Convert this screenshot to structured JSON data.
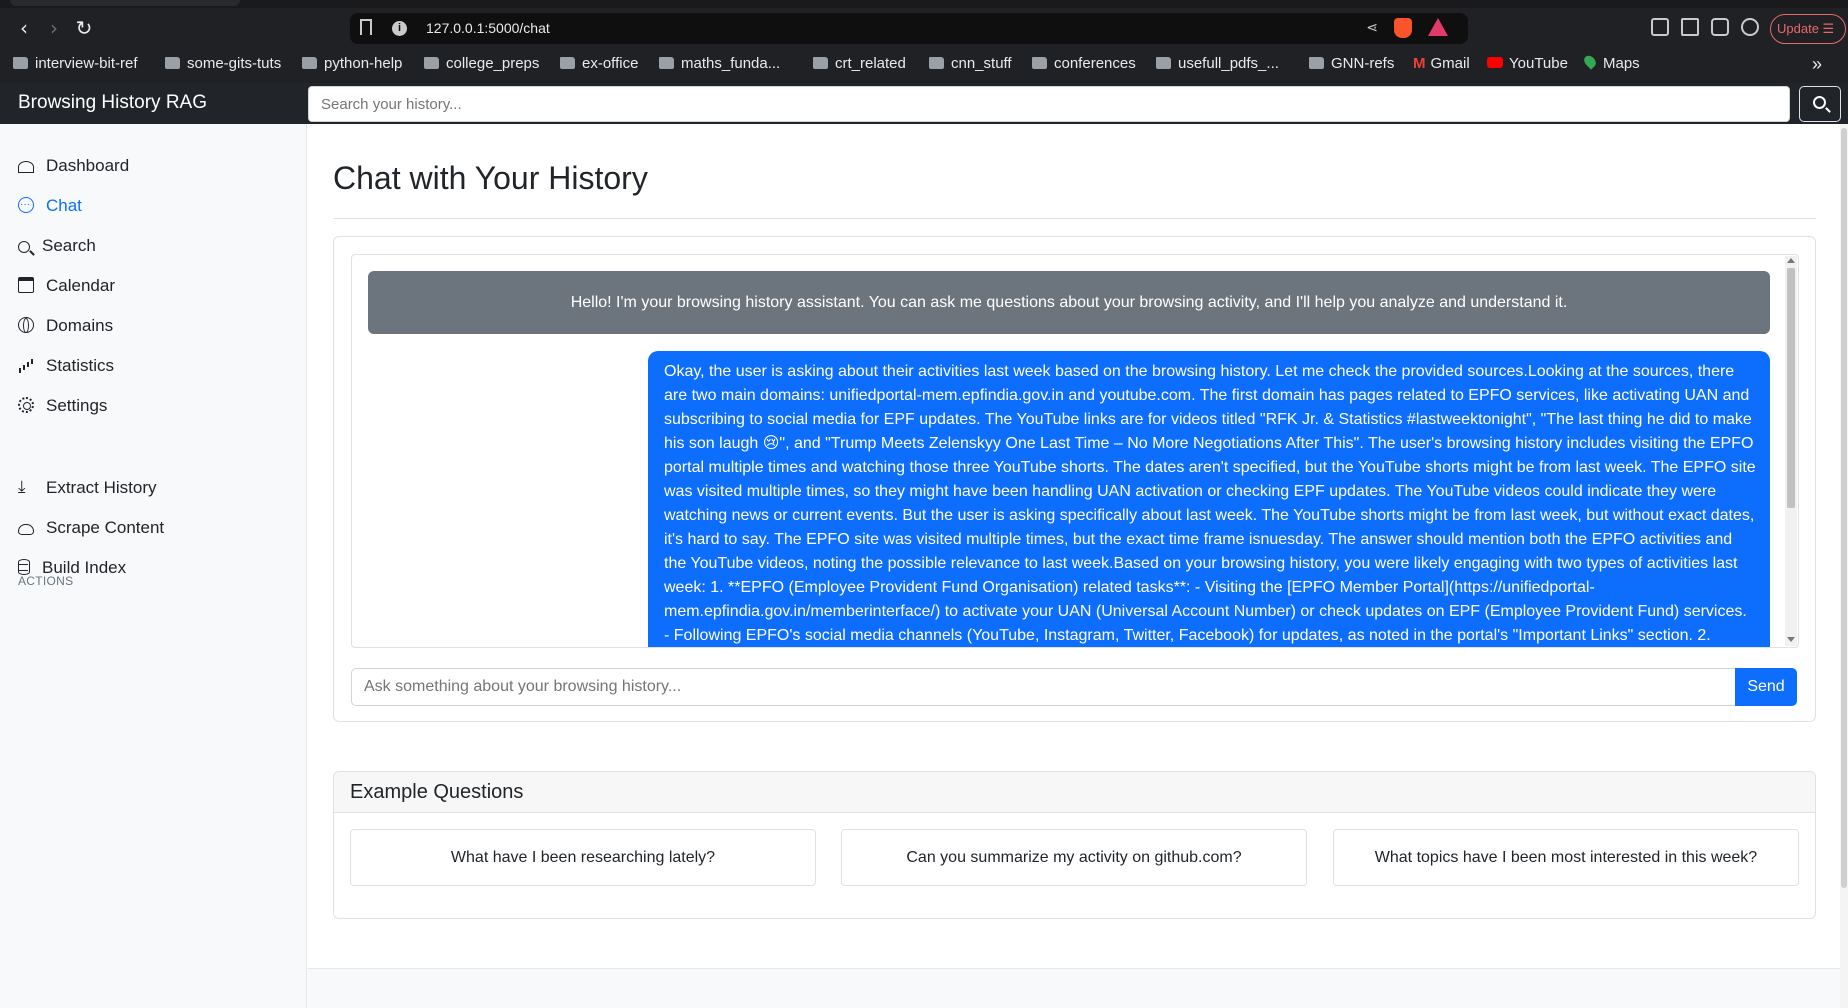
{
  "browser": {
    "url": "127.0.0.1:5000/chat",
    "update_label": "Update",
    "bookmarks": [
      "interview-bit-ref",
      "some-gits-tuts",
      "python-help",
      "college_preps",
      "ex-office",
      "maths_funda...",
      "crt_related",
      "cnn_stuff",
      "conferences",
      "usefull_pdfs_...",
      "GNN-refs",
      "Gmail",
      "YouTube",
      "Maps"
    ]
  },
  "navbar": {
    "brand": "Browsing History RAG",
    "search_placeholder": "Search your history..."
  },
  "sidebar": {
    "items": [
      {
        "label": "Dashboard",
        "icon": "speedometer-icon"
      },
      {
        "label": "Chat",
        "icon": "chat-icon",
        "active": true
      },
      {
        "label": "Search",
        "icon": "search-icon"
      },
      {
        "label": "Calendar",
        "icon": "calendar-icon"
      },
      {
        "label": "Domains",
        "icon": "globe-icon"
      },
      {
        "label": "Statistics",
        "icon": "bar-chart-icon"
      },
      {
        "label": "Settings",
        "icon": "gear-icon"
      }
    ],
    "actions_heading": "ACTIONS",
    "actions": [
      {
        "label": "Extract History",
        "icon": "download-icon"
      },
      {
        "label": "Scrape Content",
        "icon": "cloud-download-icon"
      },
      {
        "label": "Build Index",
        "icon": "database-icon"
      }
    ]
  },
  "main": {
    "title": "Chat with Your History",
    "bot_message": "Hello! I'm your browsing history assistant. You can ask me questions about your browsing activity, and I'll help you analyze and understand it.",
    "user_message": "Okay, the user is asking about their activities last week based on the browsing history. Let me check the provided sources.Looking at the sources, there are two main domains: unifiedportal-mem.epfindia.gov.in and youtube.com. The first domain has pages related to EPFO services, like activating UAN and subscribing to social media for EPF updates. The YouTube links are for videos titled \"RFK Jr. & Statistics #lastweektonight\", \"The last thing he did to make his son laugh 😢\", and \"Trump Meets Zelenskyy One Last Time – No More Negotiations After This\". The user's browsing history includes visiting the EPFO portal multiple times and watching those three YouTube shorts. The dates aren't specified, but the YouTube shorts might be from last week. The EPFO site was visited multiple times, so they might have been handling UAN activation or checking EPF updates. The YouTube videos could indicate they were watching news or current events. But the user is asking specifically about last week. The YouTube shorts might be from last week, but without exact dates, it's hard to say. The EPFO site was visited multiple times, but the exact time frame isnuesday. The answer should mention both the EPFO activities and the YouTube videos, noting the possible relevance to last week.Based on your browsing history, you were likely engaging with two types of activities last week: 1. **EPFO (Employee Provident Fund Organisation) related tasks**: - Visiting the [EPFO Member Portal](https://unifiedportal-mem.epfindia.gov.in/memberinterface/) to activate your UAN (Universal Account Number) or check updates on EPF (Employee Provident Fund) services. - Following EPFO's social media channels (YouTube, Instagram, Twitter, Facebook) for updates, as noted in the portal's \"Important Links\" section. 2.",
    "chat_placeholder": "Ask something about your browsing history...",
    "send_label": "Send",
    "examples_title": "Example Questions",
    "examples": [
      "What have I been researching lately?",
      "Can you summarize my activity on github.com?",
      "What topics have I been most interested in this week?"
    ]
  }
}
